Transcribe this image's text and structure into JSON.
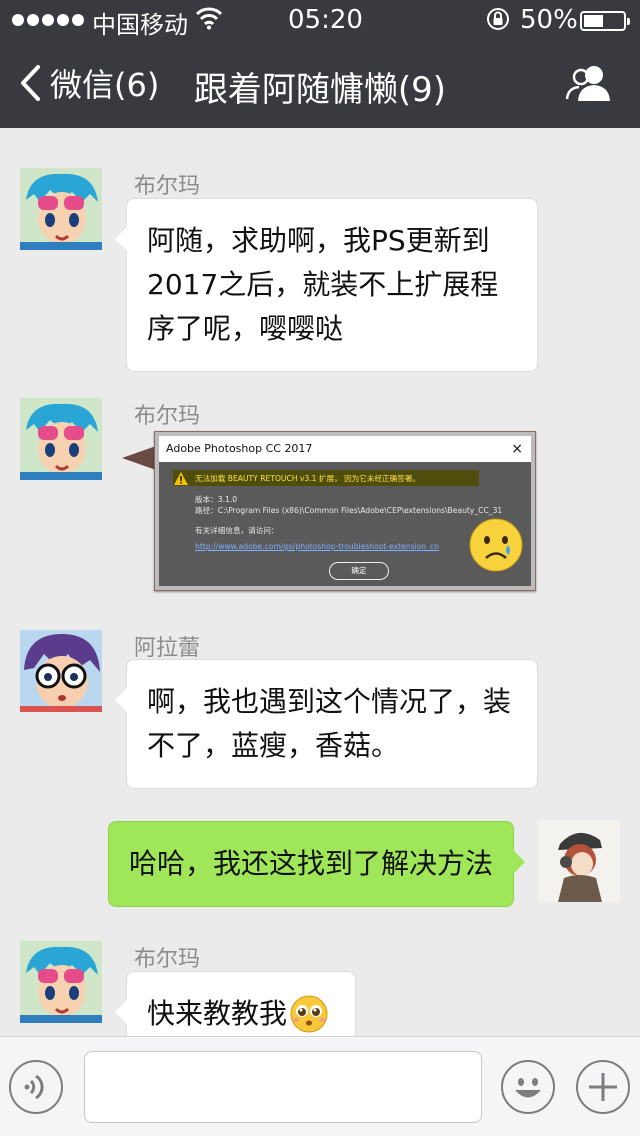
{
  "status_bar": {
    "carrier": "中国移动",
    "time": "05:20",
    "battery_percent": "50%",
    "battery_level": 0.5,
    "signal_dots": 5
  },
  "nav": {
    "back_label": "微信(6)",
    "title": "跟着阿随慵懒(9)"
  },
  "messages": [
    {
      "sender": "布尔玛",
      "type": "text",
      "text": "阿随，求助啊，我PS更新到2017之后，就装不上扩展程序了呢，嘤嘤哒"
    },
    {
      "sender": "布尔玛",
      "type": "image"
    },
    {
      "sender": "阿拉蕾",
      "type": "text",
      "text": "啊，我也遇到这个情况了，装不了，蓝瘦，香菇。"
    },
    {
      "sender": "",
      "type": "text",
      "outgoing": true,
      "text": "哈哈，我还这找到了解决方法"
    },
    {
      "sender": "布尔玛",
      "type": "text",
      "text": "快来教教我"
    }
  ],
  "dialog": {
    "title": "Adobe Photoshop CC 2017",
    "warning": "无法加载 BEAUTY RETOUCH v3.1 扩展， 因为它未经正确签署。",
    "version": "版本：3.1.0",
    "path": "路径：C:\\Program Files (x86)\\Common Files\\Adobe\\CEP\\extensions\\Beauty_CC_31",
    "info": "有关详细信息，请访问：",
    "link": "http://www.adobe.com/go/photoshop-troubleshoot-extension_cn",
    "ok": "确定"
  },
  "input": {
    "value": "",
    "placeholder": ""
  },
  "colors": {
    "nav_bg": "#393a3f",
    "chat_bg": "#ebebeb",
    "outgoing_bubble": "#9fe658",
    "incoming_bubble": "#ffffff"
  },
  "icons": [
    "wifi-icon",
    "rotation-lock-icon",
    "battery-icon",
    "back-chevron-icon",
    "group-members-icon",
    "voice-icon",
    "emoji-icon",
    "plus-icon"
  ]
}
